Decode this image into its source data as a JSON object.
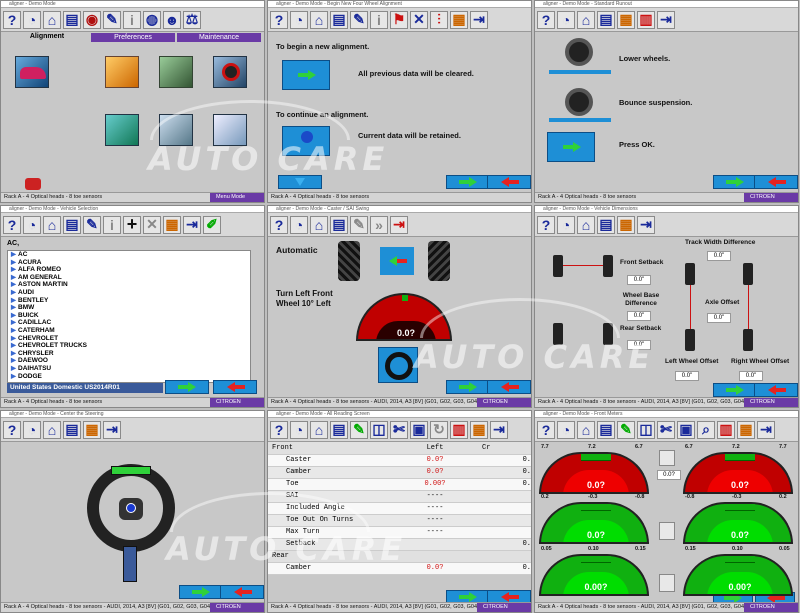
{
  "panels": {
    "p1": {
      "titlebar": "aligner - Demo Mode",
      "tabs": [
        "Alignment",
        "Preferences",
        "Maintenance"
      ],
      "status": "Rack A - 4 Optical heads - 8 toe sensors",
      "badge": "Menu Mode"
    },
    "p2": {
      "titlebar": "aligner - Demo Mode - Begin New Four Wheel Alignment",
      "begin_title": "To begin a new alignment.",
      "begin_desc": "All previous data will be cleared.",
      "continue_title": "To continue an alignment.",
      "continue_desc": "Current data will be retained.",
      "status": "Rack A - 4 Optical heads - 8 toe sensors"
    },
    "p3": {
      "titlebar": "aligner - Demo Mode - Standard Runout",
      "step1": "Lower wheels.",
      "step2": "Bounce suspension.",
      "step3": "Press OK.",
      "status": "Rack A - 4 Optical heads - 8 toe sensors",
      "badge": "CITROEN"
    },
    "p4": {
      "titlebar": "aligner - Demo Mode - Vehicle Selection",
      "search": "AC,",
      "makes": [
        "AC",
        "ACURA",
        "ALFA ROMEO",
        "AM GENERAL",
        "ASTON MARTIN",
        "AUDI",
        "BENTLEY",
        "BMW",
        "BUICK",
        "CADILLAC",
        "CATERHAM",
        "CHEVROLET",
        "CHEVROLET TRUCKS",
        "CHRYSLER",
        "DAEWOO",
        "DAIHATSU",
        "DODGE"
      ],
      "database": "United States Domestic US2014R01",
      "status": "Rack A - 4 Optical heads - 8 toe sensors",
      "badge": "CITROEN"
    },
    "p5": {
      "titlebar": "aligner - Demo Mode - Caster / SAI Swing",
      "mode": "Automatic",
      "instruction_line1": "Turn Left Front",
      "instruction_line2": "Wheel 10° Left",
      "gauge_value": "0.0?",
      "status": "Rack A - 4 Optical heads - 8 toe sensors - AUDI, 2014, A3 [8V] (G01, G02, G03, G04, G2",
      "badge": "CITROEN"
    },
    "p6": {
      "titlebar": "aligner - Demo Mode - Vehicle Dimensions",
      "track_width": "Track Width Difference",
      "front_setback": "Front Setback",
      "wheel_base": "Wheel Base Difference",
      "rear_setback": "Rear Setback",
      "axle_offset": "Axle Offset",
      "left_offset": "Left Wheel Offset",
      "right_offset": "Right Wheel Offset",
      "v_track": "0.0\"",
      "v_front": "0.0\"",
      "v_wheel": "0.0\"",
      "v_rear": "0.0\"",
      "v_axle": "0.0\"",
      "v_left": "0.0\"",
      "v_right": "0.0\"",
      "status": "Rack A - 4 Optical heads - 8 toe sensors - AUDI, 2014, A3 [8V] (G01, G02, G03, G04, G2",
      "badge": "CITROEN"
    },
    "p7": {
      "titlebar": "aligner - Demo Mode - Center the Steering",
      "status": "Rack A - 4 Optical heads - 8 toe sensors - AUDI, 2014, A3 [8V] (G01, G02, G03, G04, G2",
      "badge": "CITROEN"
    },
    "p8": {
      "titlebar": "aligner - Demo Mode - All Reading Screen",
      "head_front": "Front",
      "head_left": "Left",
      "head_cross": "Cr",
      "rows": [
        {
          "label": "Caster",
          "left": "0.0?",
          "cross": "0."
        },
        {
          "label": "Camber",
          "left": "0.0?",
          "cross": "0."
        },
        {
          "label": "Toe",
          "left": "0.00?",
          "cross": "0."
        },
        {
          "label": "SAI",
          "left": "----",
          "cross": ""
        },
        {
          "label": "Included Angle",
          "left": "----",
          "cross": ""
        },
        {
          "label": "Toe Out On Turns",
          "left": "----",
          "cross": ""
        },
        {
          "label": "Max Turn",
          "left": "----",
          "cross": ""
        },
        {
          "label": "Setback",
          "left": "",
          "cross": "0."
        }
      ],
      "head_rear": "Rear",
      "rear_rows": [
        {
          "label": "Camber",
          "left": "0.0?",
          "cross": "0."
        }
      ],
      "status": "Rack A - 4 Optical heads - 8 toe sensors - AUDI, 2014, A3 [8V] (G01, G02, G03, G04, G2",
      "badge": "CITROEN"
    },
    "p9": {
      "titlebar": "aligner - Demo Mode - Front Meters",
      "g_tl": {
        "value": "0.0?",
        "min": "7.7",
        "mid": "7.2",
        "max": "6.7"
      },
      "g_tr": {
        "value": "0.0?",
        "min": "6.7",
        "mid": "7.2",
        "max": "7.7"
      },
      "g_ml": {
        "value": "0.0?",
        "min": "0.2",
        "mid": "-0.3",
        "max": "-0.8"
      },
      "g_mr": {
        "value": "0.0?",
        "min": "-0.8",
        "mid": "-0.3",
        "max": "0.2"
      },
      "g_bl": {
        "value": "0.00?",
        "min": "0.05",
        "mid": "0.10",
        "max": "0.15"
      },
      "g_br": {
        "value": "0.00?",
        "min": "0.15",
        "mid": "0.10",
        "max": "0.05"
      },
      "mid_val": "0.0?",
      "status": "Rack A - 4 Optical heads - 8 toe sensors - AUDI, 2014, A3 [8V] (G01, G02, G03, G04, G2",
      "badge": "CITROEN"
    }
  },
  "watermark": "AUTO CARE",
  "colors": {
    "accent": "#1e8fd6",
    "ok": "#2fd13a",
    "cancel": "#e52320",
    "badge": "#6a3aa6",
    "gauge_red": "#c00000",
    "gauge_green": "#10b010"
  }
}
